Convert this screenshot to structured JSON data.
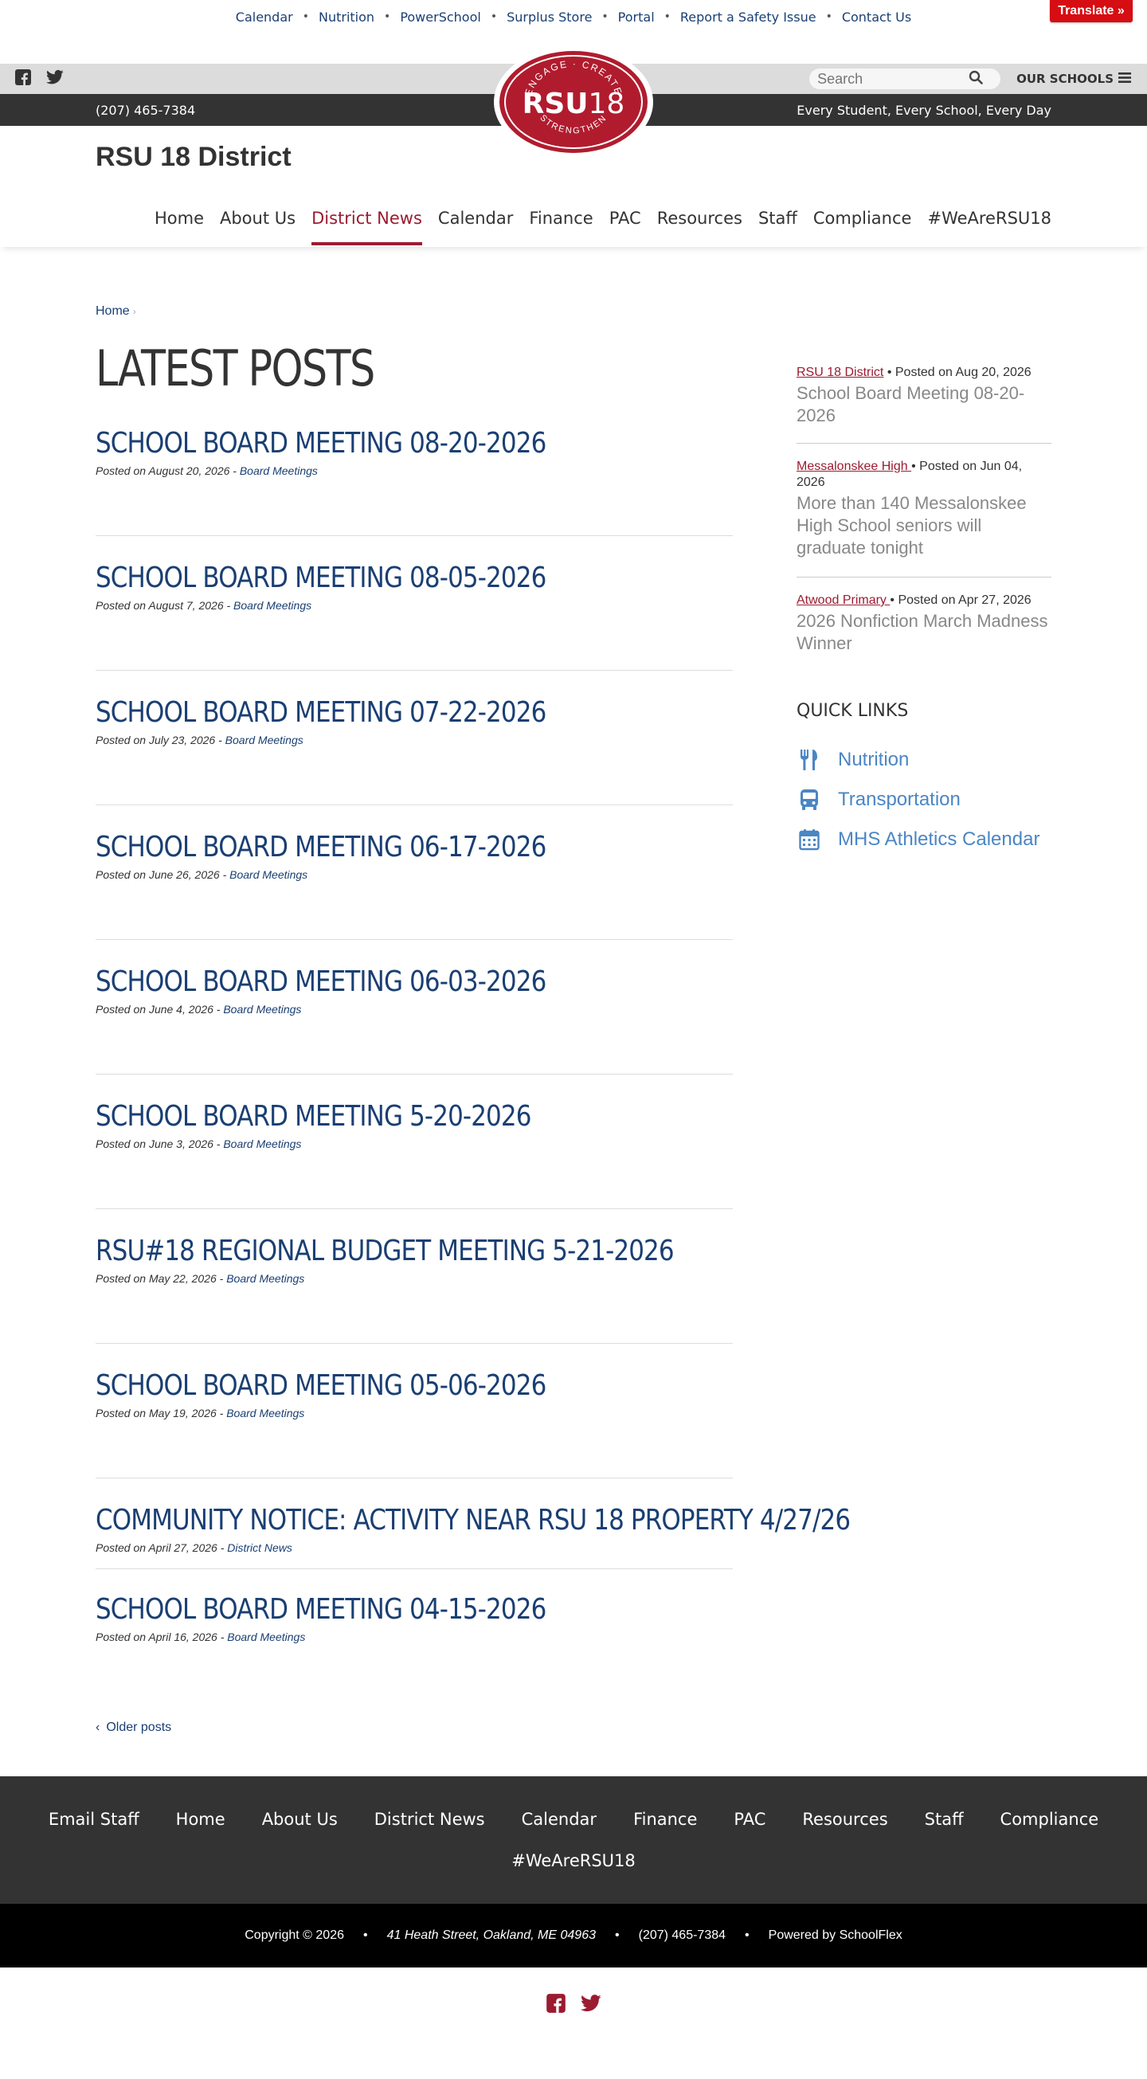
{
  "utility": {
    "links": [
      "Calendar",
      "Nutrition",
      "PowerSchool",
      "Surplus Store",
      "Portal",
      "Report a Safety Issue",
      "Contact Us"
    ],
    "separator": "•",
    "translate": "Translate »"
  },
  "search": {
    "placeholder": "Search"
  },
  "schools_button": "OUR SCHOOLS",
  "contact_bar": {
    "phone": "(207) 465-7384",
    "tagline": "Every Student, Every School, Every Day"
  },
  "logo": {
    "top_text": "ENGAGE · CREATE",
    "main": "RSU",
    "num": "18",
    "bottom_text": "STRENGTHEN",
    "color": "#b01c2e"
  },
  "site_title": "RSU 18 District",
  "main_nav": [
    "Home",
    "About Us",
    "District News",
    "Calendar",
    "Finance",
    "PAC",
    "Resources",
    "Staff",
    "Compliance",
    "#WeAreRSU18"
  ],
  "active_nav": "District News",
  "breadcrumb": {
    "home": "Home",
    "chevron": "›"
  },
  "page_title": "LATEST POSTS",
  "posts": [
    {
      "title": "SCHOOL BOARD MEETING 08-20-2026",
      "date": "Posted on August 20, 2026 - ",
      "category": "Board Meetings"
    },
    {
      "title": "SCHOOL BOARD MEETING 08-05-2026",
      "date": "Posted on August 7, 2026 - ",
      "category": "Board Meetings"
    },
    {
      "title": "SCHOOL BOARD MEETING 07-22-2026",
      "date": "Posted on July 23, 2026 - ",
      "category": "Board Meetings"
    },
    {
      "title": "SCHOOL BOARD MEETING 06-17-2026",
      "date": "Posted on June 26, 2026 - ",
      "category": "Board Meetings"
    },
    {
      "title": "SCHOOL BOARD MEETING 06-03-2026",
      "date": "Posted on June 4, 2026 - ",
      "category": "Board Meetings"
    },
    {
      "title": "SCHOOL BOARD MEETING 5-20-2026",
      "date": "Posted on June 3, 2026 - ",
      "category": "Board Meetings"
    },
    {
      "title": "RSU#18 REGIONAL BUDGET MEETING 5-21-2026",
      "date": "Posted on May 22, 2026 - ",
      "category": "Board Meetings"
    },
    {
      "title": "SCHOOL BOARD MEETING 05-06-2026",
      "date": "Posted on May 19, 2026 - ",
      "category": "Board Meetings"
    },
    {
      "title": "COMMUNITY NOTICE: ACTIVITY NEAR RSU 18 PROPERTY 4/27/26",
      "date": "Posted on April 27, 2026 - ",
      "category": "District News"
    },
    {
      "title": "SCHOOL BOARD MEETING 04-15-2026",
      "date": "Posted on April 16, 2026 - ",
      "category": "Board Meetings"
    }
  ],
  "older_posts": {
    "chevron": "‹",
    "label": "Older posts"
  },
  "recent": [
    {
      "school": "RSU 18 District",
      "posted": "Posted on Aug 20, 2026",
      "title": "School Board Meeting 08-20-2026"
    },
    {
      "school": "Messalonskee High ",
      "posted": "Posted on Jun 04, 2026",
      "title": "More than 140 Messalonskee High School seniors will graduate tonight"
    },
    {
      "school": "Atwood Primary ",
      "posted": "Posted on Apr 27, 2026",
      "title": "2026 Nonfiction March Madness Winner"
    }
  ],
  "recent_dot": "•",
  "quick_links": {
    "title": "QUICK LINKS",
    "items": [
      {
        "label": "Nutrition",
        "icon": "utensils-icon"
      },
      {
        "label": "Transportation",
        "icon": "bus-icon"
      },
      {
        "label": "MHS Athletics Calendar",
        "icon": "calendar-icon"
      }
    ]
  },
  "footer_nav": {
    "row1": [
      "Email Staff",
      "Home",
      "About Us",
      "District News",
      "Calendar",
      "Finance",
      "PAC",
      "Resources",
      "Staff",
      "Compliance"
    ],
    "row2": [
      "#WeAreRSU18"
    ]
  },
  "copyright": {
    "text": "Copyright © 2026",
    "address": "41 Heath Street, Oakland, ME 04963",
    "phone": "(207) 465-7384",
    "powered": "Powered by SchoolFlex",
    "separator": "•"
  },
  "colors": {
    "brand_red": "#9b1b30",
    "link_blue": "#1a3f73",
    "quick_blue": "#4a86c5",
    "translate_red": "#d60d12"
  }
}
